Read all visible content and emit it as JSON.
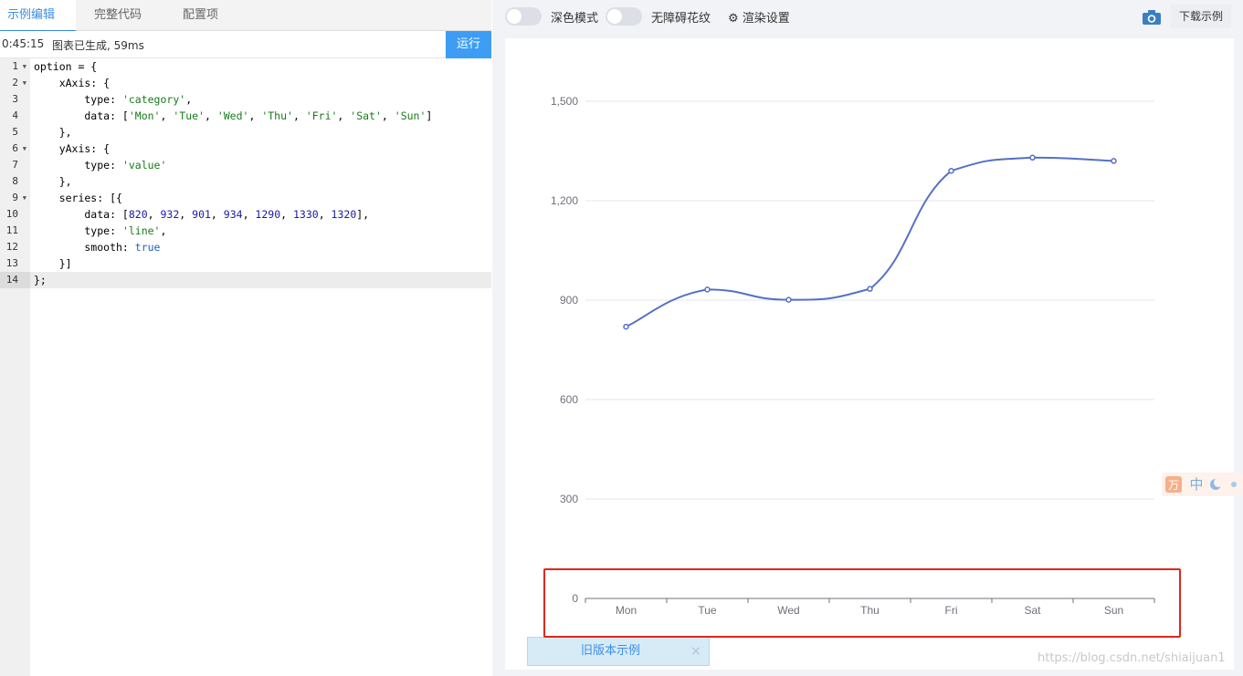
{
  "tabs": [
    {
      "label": "示例编辑",
      "active": true
    },
    {
      "label": "完整代码",
      "active": false
    },
    {
      "label": "配置项",
      "active": false
    }
  ],
  "status": {
    "time": "0:45:15",
    "message": "图表已生成, 59ms"
  },
  "run_button": "运行",
  "editor": {
    "line_numbers": [
      "1",
      "2",
      "3",
      "4",
      "5",
      "6",
      "7",
      "8",
      "9",
      "10",
      "11",
      "12",
      "13",
      "14"
    ],
    "active_line": "14"
  },
  "toolbar": {
    "dark_mode_label": "深色模式",
    "accessible_label": "无障碍花纹",
    "render_settings_label": "渲染设置",
    "download_label": "下载示例"
  },
  "chart_data": {
    "type": "line",
    "smooth": true,
    "categories": [
      "Mon",
      "Tue",
      "Wed",
      "Thu",
      "Fri",
      "Sat",
      "Sun"
    ],
    "values": [
      820,
      932,
      901,
      934,
      1290,
      1330,
      1320
    ],
    "y_ticks": [
      "0",
      "300",
      "600",
      "900",
      "1,200",
      "1,500"
    ],
    "ylim": [
      0,
      1500
    ],
    "line_color": "#5470c6",
    "grid": true
  },
  "old_version_label": "旧版本示例",
  "close_symbol": "×",
  "side_widget_text": "中",
  "watermark": "https://blog.csdn.net/shiaijuan1"
}
